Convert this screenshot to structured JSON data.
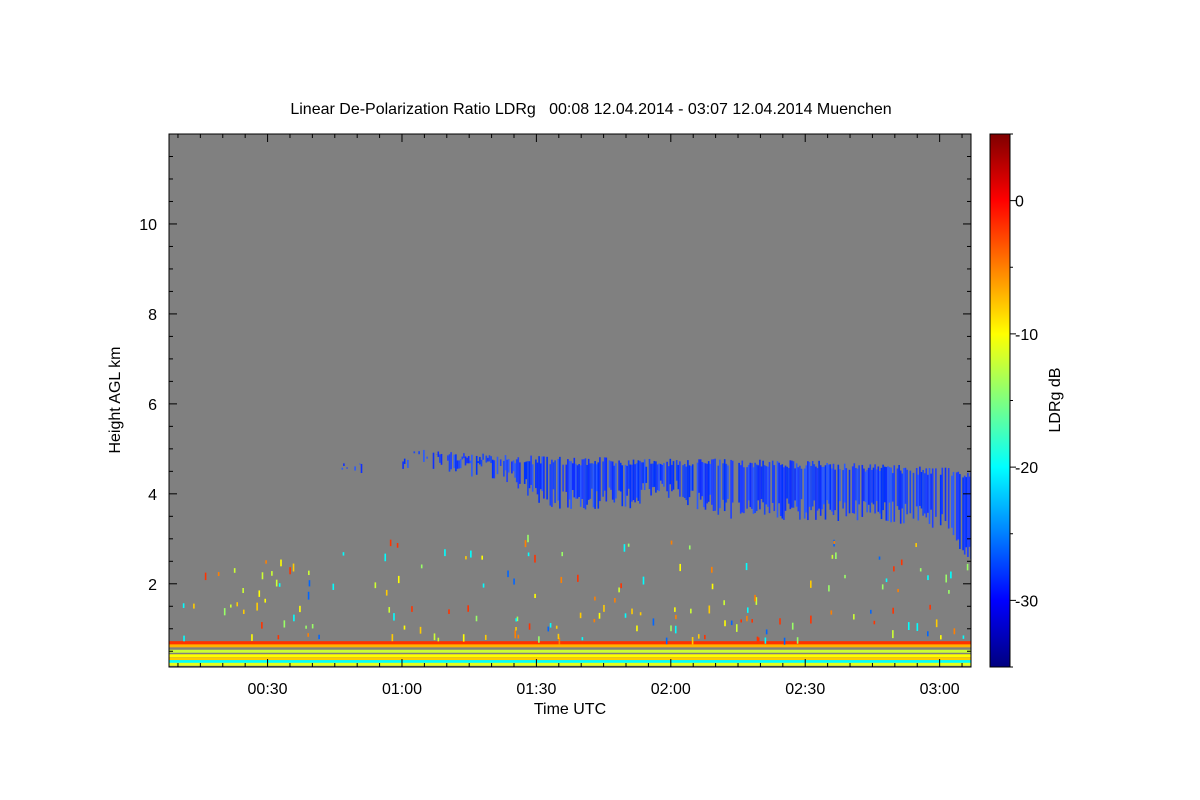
{
  "chart_data": {
    "type": "heatmap",
    "title": "Linear De-Polarization Ratio LDRg   00:08 12.04.2014 - 03:07 12.04.2014 Muenchen",
    "xlabel": "Time UTC",
    "ylabel": "Height AGL km",
    "colorbar_label": "LDRg dB",
    "x_range_minutes": [
      8,
      187
    ],
    "y_range_km": [
      0.15,
      12
    ],
    "x_ticks": [
      {
        "value": 30,
        "label": "00:30"
      },
      {
        "value": 60,
        "label": "01:00"
      },
      {
        "value": 90,
        "label": "01:30"
      },
      {
        "value": 120,
        "label": "02:00"
      },
      {
        "value": 150,
        "label": "02:30"
      },
      {
        "value": 180,
        "label": "03:00"
      }
    ],
    "y_ticks": [
      {
        "value": 2,
        "label": "2"
      },
      {
        "value": 4,
        "label": "4"
      },
      {
        "value": 6,
        "label": "6"
      },
      {
        "value": 8,
        "label": "8"
      },
      {
        "value": 10,
        "label": "10"
      }
    ],
    "colorbar_range_db": [
      -35,
      5
    ],
    "colorbar_ticks": [
      {
        "value": 0,
        "label": "0"
      },
      {
        "value": -10,
        "label": "-10"
      },
      {
        "value": -20,
        "label": "-20"
      },
      {
        "value": -30,
        "label": "-30"
      }
    ],
    "no_data_color": "#808080",
    "colormap": "jet",
    "features": [
      {
        "name": "cloud-layer",
        "ldr_db": -30,
        "note": "ice cloud layer roughly 3.5–4.8 km from 00:44 to 03:07, descending to about 2.5 km at the end"
      },
      {
        "name": "near-surface-layers",
        "ldr_db_values": [
          -2,
          -8,
          -12,
          -20
        ],
        "height_km": [
          0.2,
          0.7
        ]
      }
    ]
  }
}
